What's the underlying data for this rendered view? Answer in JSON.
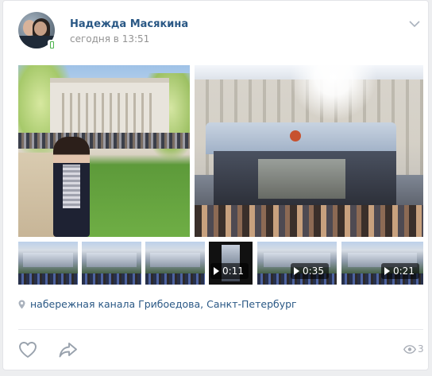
{
  "post": {
    "author": "Надежда Масякина",
    "time": "сегодня в 13:51",
    "location": "набережная канала Грибоедова, Санкт-Петербург",
    "views": "3"
  },
  "videos": [
    {
      "duration": "0:11"
    },
    {
      "duration": "0:35"
    },
    {
      "duration": "0:21"
    }
  ],
  "icons": {
    "more": "chevron-down-icon",
    "like": "heart-icon",
    "share": "share-arrow-icon",
    "views": "eye-icon",
    "location": "location-pin-icon",
    "online": "mobile-online-icon"
  },
  "colors": {
    "link": "#2a5885",
    "muted": "#939393",
    "icon": "#a8adb6",
    "online": "#4bb34b"
  }
}
